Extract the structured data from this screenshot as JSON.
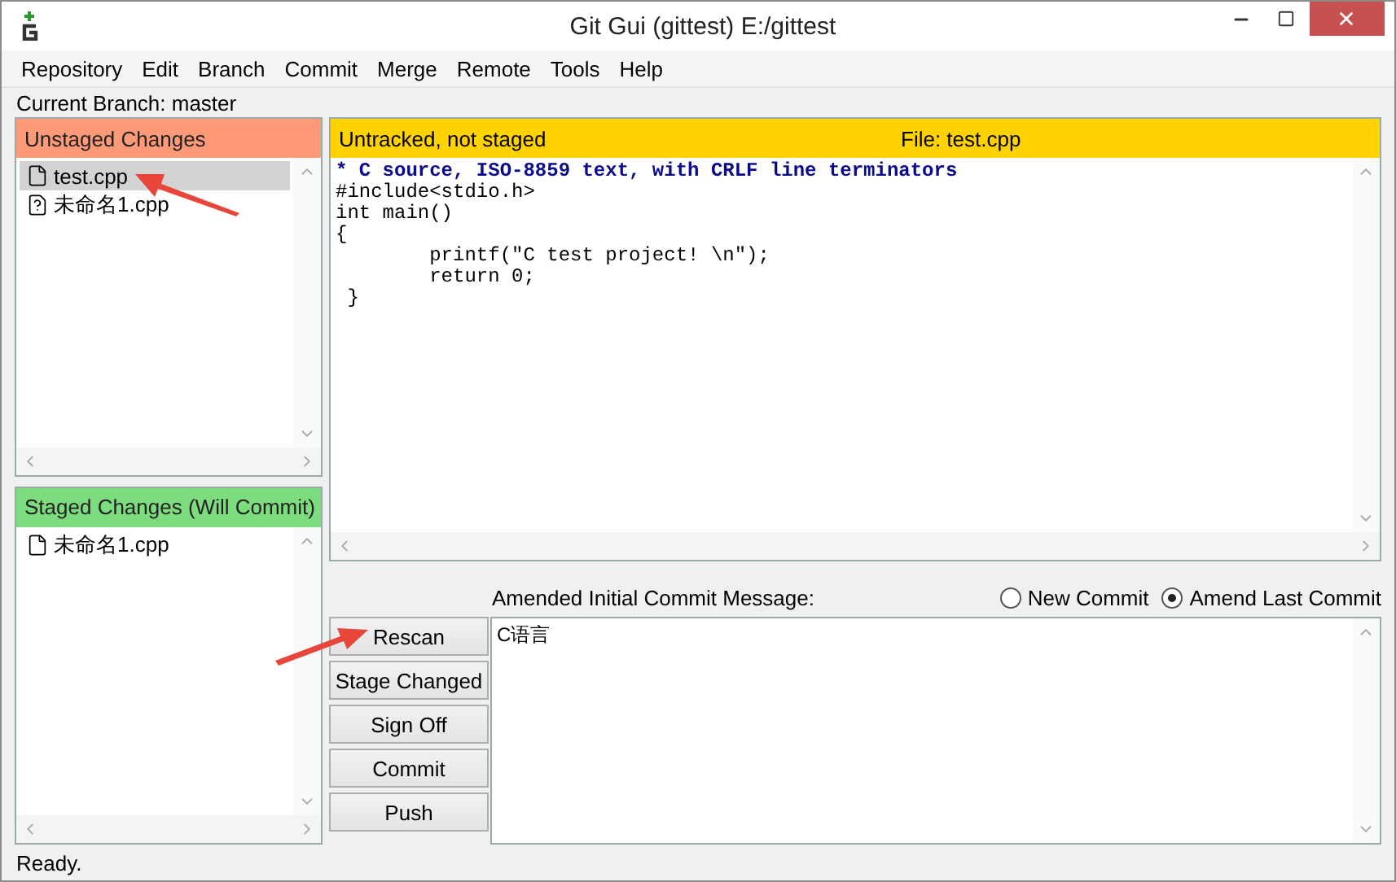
{
  "window": {
    "title": "Git Gui (gittest) E:/gittest"
  },
  "menu": [
    "Repository",
    "Edit",
    "Branch",
    "Commit",
    "Merge",
    "Remote",
    "Tools",
    "Help"
  ],
  "current_branch": "Current Branch: master",
  "unstaged": {
    "title": "Unstaged Changes",
    "files": [
      {
        "name": "test.cpp",
        "kind": "file",
        "selected": true
      },
      {
        "name": "未命名1.cpp",
        "kind": "unknown",
        "selected": false
      }
    ]
  },
  "staged": {
    "title": "Staged Changes (Will Commit)",
    "files": [
      {
        "name": "未命名1.cpp",
        "kind": "file",
        "selected": false
      }
    ]
  },
  "diff": {
    "status": "Untracked, not staged",
    "file": "File:  test.cpp",
    "lines": [
      {
        "kind": "header",
        "text": "* C source, ISO-8859 text, with CRLF line terminators"
      },
      {
        "kind": "code",
        "text": "#include<stdio.h>"
      },
      {
        "kind": "code",
        "text": "int main()"
      },
      {
        "kind": "code",
        "text": "{"
      },
      {
        "kind": "code",
        "text": "\tprintf(\"C test project! \\n\");"
      },
      {
        "kind": "code",
        "text": "\treturn 0;"
      },
      {
        "kind": "code",
        "text": " }"
      }
    ]
  },
  "commit": {
    "label": "Amended Initial Commit Message:",
    "modes": [
      {
        "label": "New Commit",
        "selected": false
      },
      {
        "label": "Amend Last Commit",
        "selected": true
      }
    ],
    "message": "C语言"
  },
  "buttons": [
    "Rescan",
    "Stage Changed",
    "Sign Off",
    "Commit",
    "Push"
  ],
  "status_bar": "Ready."
}
